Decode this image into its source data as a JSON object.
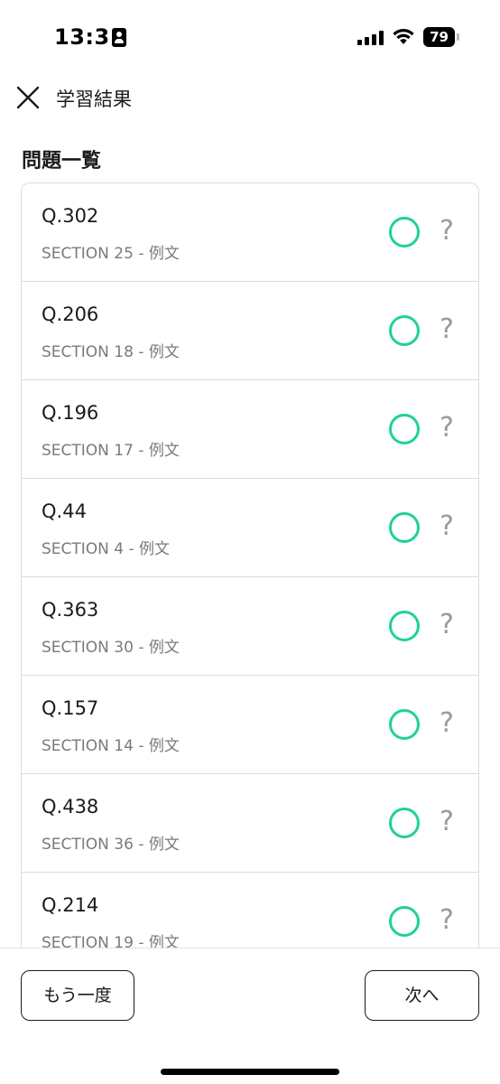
{
  "status_bar": {
    "time": "13:31",
    "battery": "79"
  },
  "header": {
    "title": "学習結果",
    "close_icon": "close-icon"
  },
  "section_title": "問題一覧",
  "colors": {
    "correct_mark": "#1fd19c",
    "question_mark": "#9a9a9a",
    "subtitle": "#7a7a7a",
    "border": "#dcdcdc"
  },
  "questions": [
    {
      "label": "Q.302",
      "section": "SECTION 25 - 例文",
      "result_icon": "circle-correct-icon",
      "help": "?"
    },
    {
      "label": "Q.206",
      "section": "SECTION 18 - 例文",
      "result_icon": "circle-correct-icon",
      "help": "?"
    },
    {
      "label": "Q.196",
      "section": "SECTION 17 - 例文",
      "result_icon": "circle-correct-icon",
      "help": "?"
    },
    {
      "label": "Q.44",
      "section": "SECTION 4 - 例文",
      "result_icon": "circle-correct-icon",
      "help": "?"
    },
    {
      "label": "Q.363",
      "section": "SECTION 30 - 例文",
      "result_icon": "circle-correct-icon",
      "help": "?"
    },
    {
      "label": "Q.157",
      "section": "SECTION 14 - 例文",
      "result_icon": "circle-correct-icon",
      "help": "?"
    },
    {
      "label": "Q.438",
      "section": "SECTION 36 - 例文",
      "result_icon": "circle-correct-icon",
      "help": "?"
    },
    {
      "label": "Q.214",
      "section": "SECTION 19 - 例文",
      "result_icon": "circle-correct-icon",
      "help": "?"
    }
  ],
  "footer": {
    "retry_label": "もう一度",
    "next_label": "次へ"
  }
}
